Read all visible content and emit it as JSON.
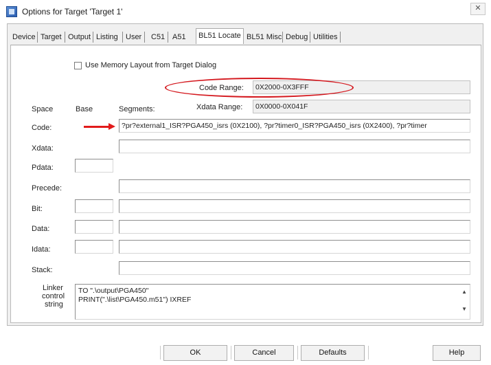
{
  "window": {
    "title": "Options for Target 'Target 1'",
    "close_glyph": "✕"
  },
  "tabs": [
    "Device",
    "Target",
    "Output",
    "Listing",
    "User",
    "C51",
    "A51",
    "BL51 Locate",
    "BL51 Misc",
    "Debug",
    "Utilities"
  ],
  "active_tab": "BL51 Locate",
  "use_memory_layout": {
    "label": "Use Memory Layout from Target Dialog",
    "checked": false
  },
  "code_range": {
    "label": "Code Range:",
    "value": "0X2000-0X3FFF"
  },
  "xdata_range": {
    "label": "Xdata Range:",
    "value": "0X0000-0X041F"
  },
  "columns": {
    "space": "Space",
    "base": "Base",
    "segments": "Segments:"
  },
  "rows": {
    "code": {
      "label": "Code:",
      "segments": "?pr?external1_ISR?PGA450_isrs (0X2100), ?pr?timer0_ISR?PGA450_isrs (0X2400), ?pr?timer"
    },
    "xdata": {
      "label": "Xdata:"
    },
    "pdata": {
      "label": "Pdata:"
    },
    "precede": {
      "label": "Precede:"
    },
    "bit": {
      "label": "Bit:"
    },
    "data": {
      "label": "Data:"
    },
    "idata": {
      "label": "Idata:"
    },
    "stack": {
      "label": "Stack:"
    }
  },
  "linker": {
    "label_line1": "Linker",
    "label_line2": "control",
    "label_line3": "string",
    "line1": "TO \".\\output\\PGA450\"",
    "line2": "PRINT(\".\\list\\PGA450.m51\") IXREF",
    "scroll_up": "▲",
    "scroll_down": "▼"
  },
  "buttons": {
    "ok": "OK",
    "cancel": "Cancel",
    "defaults": "Defaults",
    "help": "Help"
  },
  "annotation_color": "#d4181e"
}
